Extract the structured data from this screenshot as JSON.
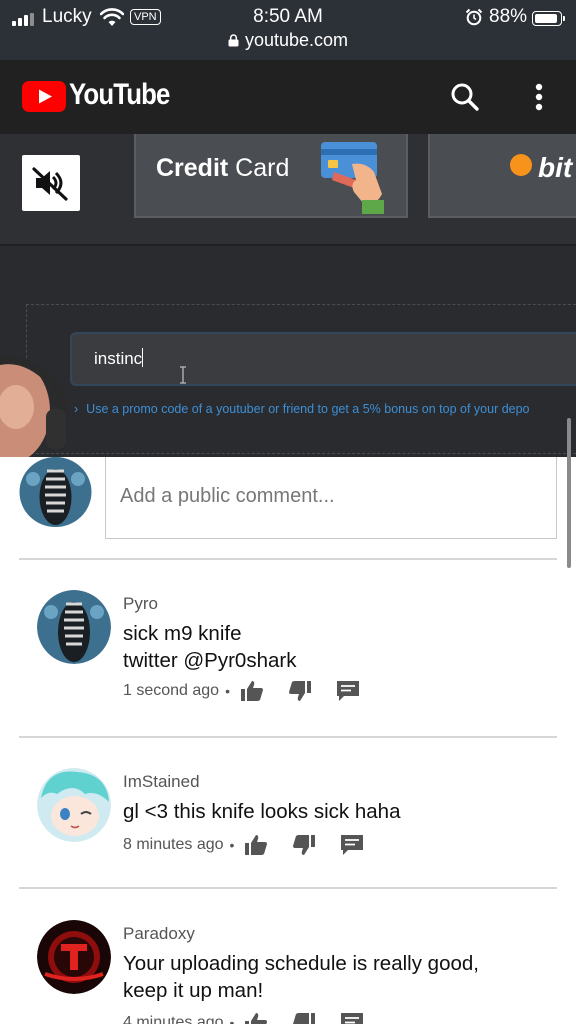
{
  "status_bar": {
    "carrier": "Lucky",
    "vpn": "VPN",
    "time": "8:50 AM",
    "battery": "88%",
    "url": "youtube.com"
  },
  "header": {
    "brand": "YouTube",
    "colors": {
      "background": "#212121",
      "logo_red": "#ff0000"
    }
  },
  "video": {
    "card_credit_bold": "Credit",
    "card_credit_rest": " Card",
    "card_bit": "bit",
    "promo_input_value": "instinc",
    "promo_hint": "Use a promo code of a youtuber or friend to get a 5% bonus on top of your depo",
    "hint_color": "#3d8fd6"
  },
  "comment_input": {
    "placeholder": "Add a public comment..."
  },
  "comments": [
    {
      "author": "Pyro",
      "text": [
        "sick m9 knife",
        "twitter @Pyr0shark"
      ],
      "time": "1 second ago"
    },
    {
      "author": "ImStained",
      "text": [
        "gl <3 this knife looks sick haha"
      ],
      "time": "8 minutes ago"
    },
    {
      "author": "Paradoxy",
      "text": [
        "Your uploading schedule is really good,",
        "keep it up man!"
      ],
      "time": "4 minutes ago"
    }
  ]
}
